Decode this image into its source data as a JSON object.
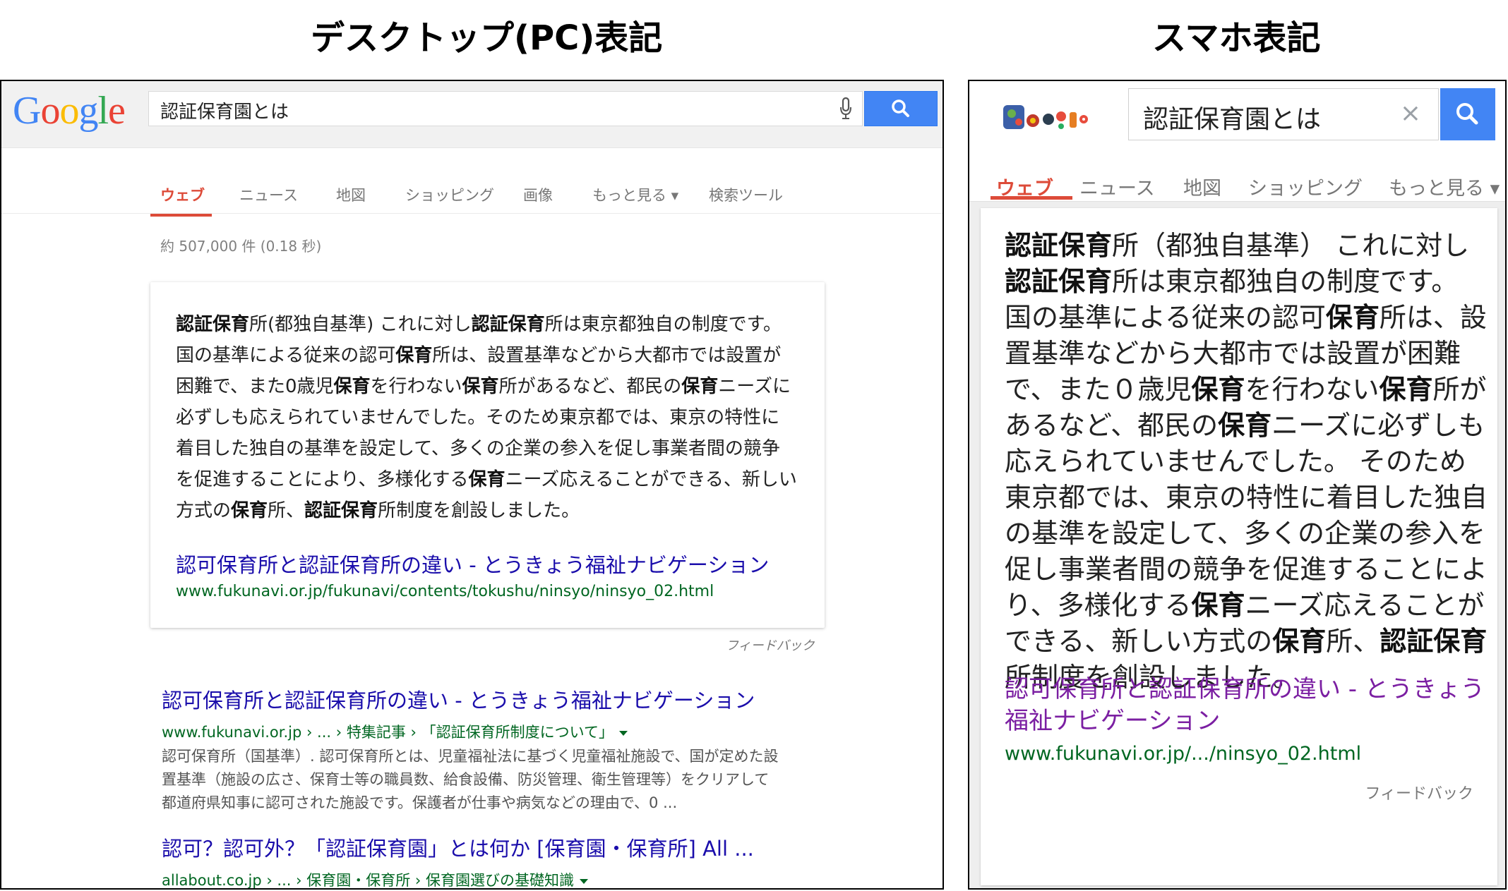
{
  "headings": {
    "desktop": "デスクトップ(PC)表記",
    "mobile": "スマホ表記"
  },
  "colors": {
    "google_blue": "#4285f4",
    "active_tab_red": "#dd4b39",
    "link_blue": "#1a0dab",
    "url_green": "#006621",
    "visited_purple": "#7b1fa2"
  },
  "desktop": {
    "logo": "Google",
    "search": {
      "query": "認証保育園とは",
      "mic_icon": "mic-icon",
      "search_icon": "search-icon"
    },
    "tabs": [
      "ウェブ",
      "ニュース",
      "地図",
      "ショッピング",
      "画像",
      "もっと見る ▾",
      "検索ツール"
    ],
    "active_tab": "ウェブ",
    "stats": "約 507,000 件 (0.18 秒)",
    "answer": {
      "segments": [
        {
          "t": "認証保育",
          "b": true
        },
        {
          "t": "所(都独自基準) これに対し",
          "b": false
        },
        {
          "t": "認証保育",
          "b": true
        },
        {
          "t": "所は東京都独自の制度です。国の基準による従来の認可",
          "b": false
        },
        {
          "t": "保育",
          "b": true
        },
        {
          "t": "所は、設置基準などから大都市では設置が困難で、また0歳児",
          "b": false
        },
        {
          "t": "保育",
          "b": true
        },
        {
          "t": "を行わない",
          "b": false
        },
        {
          "t": "保育",
          "b": true
        },
        {
          "t": "所があるなど、都民の",
          "b": false
        },
        {
          "t": "保育",
          "b": true
        },
        {
          "t": "ニーズに必ずしも応えられていませんでした。そのため東京都では、東京の特性に着目した独自の基準を設定して、多くの企業の参入を促し事業者間の競争を促進することにより、多様化する",
          "b": false
        },
        {
          "t": "保育",
          "b": true
        },
        {
          "t": "ニーズ応えることができる、新しい方式の",
          "b": false
        },
        {
          "t": "保育",
          "b": true
        },
        {
          "t": "所、",
          "b": false
        },
        {
          "t": "認証保育",
          "b": true
        },
        {
          "t": "所制度を創設しました。",
          "b": false
        }
      ],
      "title": "認可保育所と認証保育所の違い - とうきょう福祉ナビゲーション",
      "url": "www.fukunavi.or.jp/fukunavi/contents/tokushu/ninsyo/ninsyo_02.html"
    },
    "feedback": "フィードバック",
    "results": [
      {
        "title": "認可保育所と認証保育所の違い - とうきょう福祉ナビゲーション",
        "url": "www.fukunavi.or.jp › ... › 特集記事 › 「認証保育所制度について」",
        "snippet": "認可保育所（国基準）. 認可保育所とは、児童福祉法に基づく児童福祉施設で、国が定めた設置基準（施設の広さ、保育士等の職員数、給食設備、防災管理、衛生管理等）をクリアして都道府県知事に認可された施設です。保護者が仕事や病気などの理由で、0 ..."
      },
      {
        "title": "認可？認可外？「認証保育園」とは何か [保育園・保育所] All ...",
        "url": "allabout.co.jp › ... › 保育園・保育所 › 保育園選びの基礎知識",
        "snippet": ""
      }
    ]
  },
  "mobile": {
    "logo_icon": "google-doodle-icon",
    "search": {
      "query": "認証保育園とは",
      "clear": "×",
      "search_icon": "search-icon"
    },
    "tabs": [
      "ウェブ",
      "ニュース",
      "地図",
      "ショッピング",
      "もっと見る ▾"
    ],
    "active_tab": "ウェブ",
    "answer": {
      "segments": [
        {
          "t": "認証保育",
          "b": true
        },
        {
          "t": "所（都独自基準） これに対し",
          "b": false
        },
        {
          "t": "認証保育",
          "b": true
        },
        {
          "t": "所は東京都独自の制度です。 国の基準による従来の認可",
          "b": false
        },
        {
          "t": "保育",
          "b": true
        },
        {
          "t": "所は、設置基準などから大都市では設置が困難で、また０歳児",
          "b": false
        },
        {
          "t": "保育",
          "b": true
        },
        {
          "t": "を行わない",
          "b": false
        },
        {
          "t": "保育",
          "b": true
        },
        {
          "t": "所があるなど、都民の",
          "b": false
        },
        {
          "t": "保育",
          "b": true
        },
        {
          "t": "ニーズに必ずしも応えられていませんでした。 そのため東京都では、東京の特性に着目した独自の基準を設定して、多くの企業の参入を促し事業者間の競争を促進することにより、多様化する",
          "b": false
        },
        {
          "t": "保育",
          "b": true
        },
        {
          "t": "ニーズ応えることができる、新しい方式の",
          "b": false
        },
        {
          "t": "保育",
          "b": true
        },
        {
          "t": "所、",
          "b": false
        },
        {
          "t": "認証保育",
          "b": true
        },
        {
          "t": "所制度を創設しました。",
          "b": false
        }
      ],
      "title": "認可保育所と認証保育所の違い - とうきょう福祉ナビゲーション",
      "url": "www.fukunavi.or.jp/.../ninsyo_02.html"
    },
    "feedback": "フィードバック"
  }
}
